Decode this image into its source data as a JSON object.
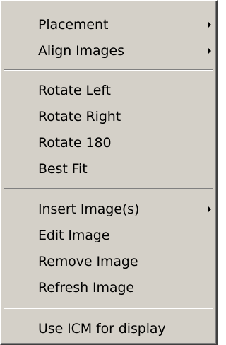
{
  "menu": {
    "groups": [
      {
        "items": [
          {
            "label": "Placement",
            "submenu": true
          },
          {
            "label": "Align Images",
            "submenu": true
          }
        ]
      },
      {
        "items": [
          {
            "label": "Rotate Left",
            "submenu": false
          },
          {
            "label": "Rotate Right",
            "submenu": false
          },
          {
            "label": "Rotate 180",
            "submenu": false
          },
          {
            "label": "Best Fit",
            "submenu": false
          }
        ]
      },
      {
        "items": [
          {
            "label": "Insert Image(s)",
            "submenu": true
          },
          {
            "label": "Edit Image",
            "submenu": false
          },
          {
            "label": "Remove Image",
            "submenu": false
          },
          {
            "label": "Refresh Image",
            "submenu": false
          }
        ]
      },
      {
        "items": [
          {
            "label": "Use ICM for display",
            "submenu": false
          }
        ]
      }
    ],
    "colors": {
      "background": "#d4d0c8",
      "text": "#000000",
      "separator_dark": "#808080",
      "separator_light": "#ffffff"
    },
    "icons": {
      "submenu": "submenu-arrow-icon"
    }
  }
}
